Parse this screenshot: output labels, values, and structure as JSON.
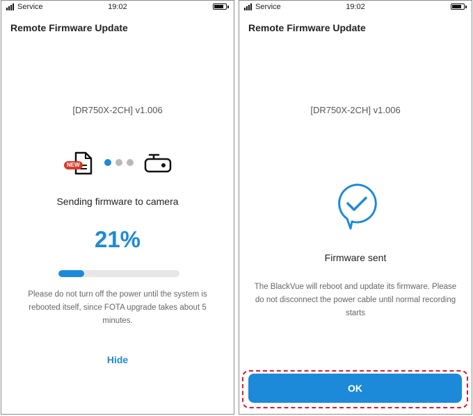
{
  "left": {
    "status": {
      "carrier": "Service",
      "time": "19:02"
    },
    "title": "Remote Firmware Update",
    "model": "[DR750X-2CH] v1.006",
    "new_badge": "NEW",
    "message": "Sending firmware to camera",
    "progress": {
      "percent_text": "21%",
      "value": 0.21
    },
    "warning": "Please do not turn off the power until the system is rebooted itself, since FOTA upgrade takes about 5 minutes.",
    "hide_label": "Hide",
    "icons": [
      "new-firmware-file-icon",
      "transfer-dots-icon",
      "dashcam-icon"
    ]
  },
  "right": {
    "status": {
      "carrier": "Service",
      "time": "19:02"
    },
    "title": "Remote Firmware Update",
    "model": "[DR750X-2CH] v1.006",
    "message": "Firmware sent",
    "description": "The BlackVue will reboot and update its firmware. Please do not disconnect the power cable until normal recording starts",
    "ok_label": "OK",
    "icons": [
      "check-bubble-icon"
    ]
  },
  "colors": {
    "accent": "#1c8ad8",
    "badge": "#d93a2b",
    "highlight": "#e0182d",
    "dot_inactive": "#b9b9b9"
  }
}
